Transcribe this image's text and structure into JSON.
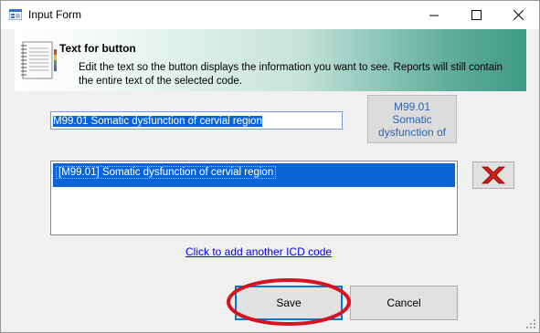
{
  "window": {
    "title": "Input Form"
  },
  "banner": {
    "title": "Text for button",
    "description": "Edit the text so the button displays the information you want to see. Reports will still contain the entire text of the selected code."
  },
  "form": {
    "text_value": "M99.01 Somatic dysfunction of cervial region",
    "preview_button": {
      "line1": "M99.01",
      "line2": "Somatic",
      "line3": "dysfunction of"
    },
    "selected_code": "[M99.01] Somatic dysfunction of cervial region",
    "add_link": "Click to add another ICD code",
    "save_label": "Save",
    "cancel_label": "Cancel"
  },
  "colors": {
    "selection": "#0a64d6",
    "banner_gradient_end": "#3f9b83",
    "highlight_circle": "#d7131f",
    "link": "#0000ee"
  },
  "icons": [
    "form-app-icon",
    "minimize-icon",
    "maximize-icon",
    "close-icon",
    "document-list-icon",
    "delete-x-icon",
    "resize-grip-icon"
  ]
}
